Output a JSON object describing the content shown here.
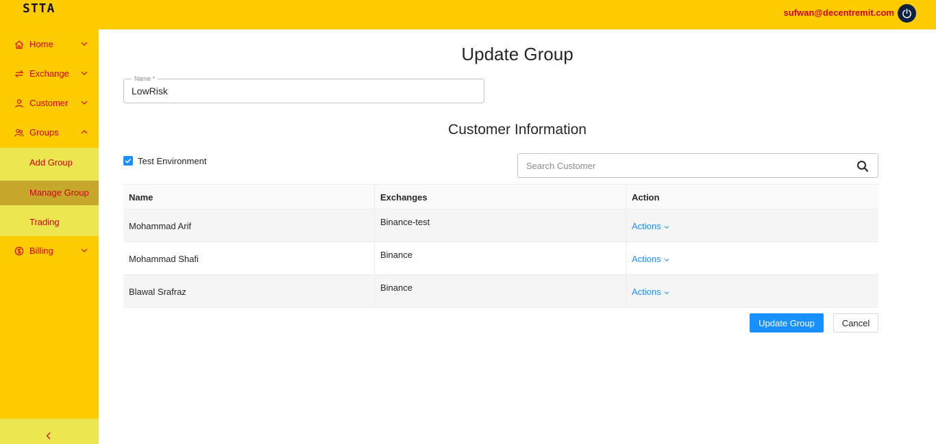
{
  "header": {
    "logo": "STTA",
    "user_email": "sufwan@decentremit.com",
    "power_icon": "power-icon"
  },
  "sidebar": {
    "items": [
      {
        "label": "Home",
        "icon": "home-icon",
        "expanded": false
      },
      {
        "label": "Exchange",
        "icon": "exchange-icon",
        "expanded": false
      },
      {
        "label": "Customer",
        "icon": "user-icon",
        "expanded": false
      },
      {
        "label": "Groups",
        "icon": "group-icon",
        "expanded": true
      },
      {
        "label": "Billing",
        "icon": "billing-icon",
        "expanded": false
      }
    ],
    "groups_submenu": [
      {
        "label": "Add Group",
        "active": false
      },
      {
        "label": "Manage Group",
        "active": true
      },
      {
        "label": "Trading",
        "active": false
      }
    ],
    "collapse_icon": "chevron-left-icon"
  },
  "main": {
    "title": "Update Group",
    "name_field": {
      "label": "Name *",
      "value": "LowRisk"
    },
    "section_title": "Customer Information",
    "test_environment": {
      "label": "Test Environment",
      "checked": true
    },
    "search": {
      "placeholder": "Search Customer"
    },
    "table": {
      "columns": [
        "Name",
        "Exchanges",
        "Action"
      ],
      "rows": [
        {
          "name": "Mohammad Arif",
          "exchanges": "Binance-test",
          "action": "Actions"
        },
        {
          "name": "Mohammad Shafi",
          "exchanges": "Binance",
          "action": "Actions"
        },
        {
          "name": "Blawal Srafraz",
          "exchanges": "Binance",
          "action": "Actions"
        }
      ]
    },
    "buttons": {
      "update": "Update Group",
      "cancel": "Cancel"
    }
  },
  "colors": {
    "brand_yellow": "#ffcc00",
    "submenu_yellow": "#ece750",
    "active_submenu": "#c6a82b",
    "menu_text_red": "#d0021b",
    "primary_blue": "#1890ff",
    "power_button": "#0d2240"
  }
}
